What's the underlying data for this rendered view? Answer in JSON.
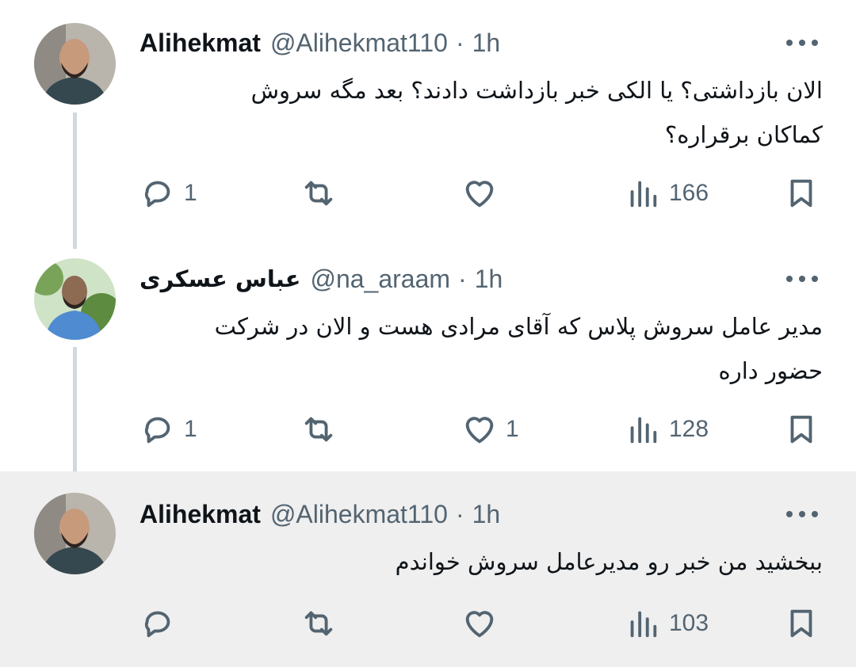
{
  "tweets": [
    {
      "name": "Alihekmat",
      "handle": "@Alihekmat110",
      "separator": "·",
      "time": "1h",
      "text_lines": [
        "الان بازداشتی؟ یا الکی خبر بازداشت دادند؟ بعد مگه سروش",
        "کماکان برقراره؟"
      ],
      "replies": "1",
      "retweets": "",
      "likes": "",
      "views": "166"
    },
    {
      "name": "عباس عسکری",
      "handle": "@na_araam",
      "separator": "·",
      "time": "1h",
      "text_lines": [
        "مدیر عامل  سروش پلاس که آقای مرادی هست و الان در شرکت",
        "حضور داره"
      ],
      "replies": "1",
      "retweets": "",
      "likes": "1",
      "views": "128"
    },
    {
      "name": "Alihekmat",
      "handle": "@Alihekmat110",
      "separator": "·",
      "time": "1h",
      "text_lines": [
        "ببخشید من خبر رو مدیرعامل سروش خواندم"
      ],
      "replies": "",
      "retweets": "",
      "likes": "",
      "views": "103"
    }
  ],
  "icons": {
    "reply": "reply-icon",
    "retweet": "retweet-icon",
    "like": "heart-icon",
    "views": "views-icon",
    "bookmark": "bookmark-icon",
    "more": "more-icon"
  },
  "colors": {
    "text": "#0f1419",
    "secondary": "#536471",
    "thread_line": "#cfd9de",
    "highlight_bg": "#efefef"
  }
}
